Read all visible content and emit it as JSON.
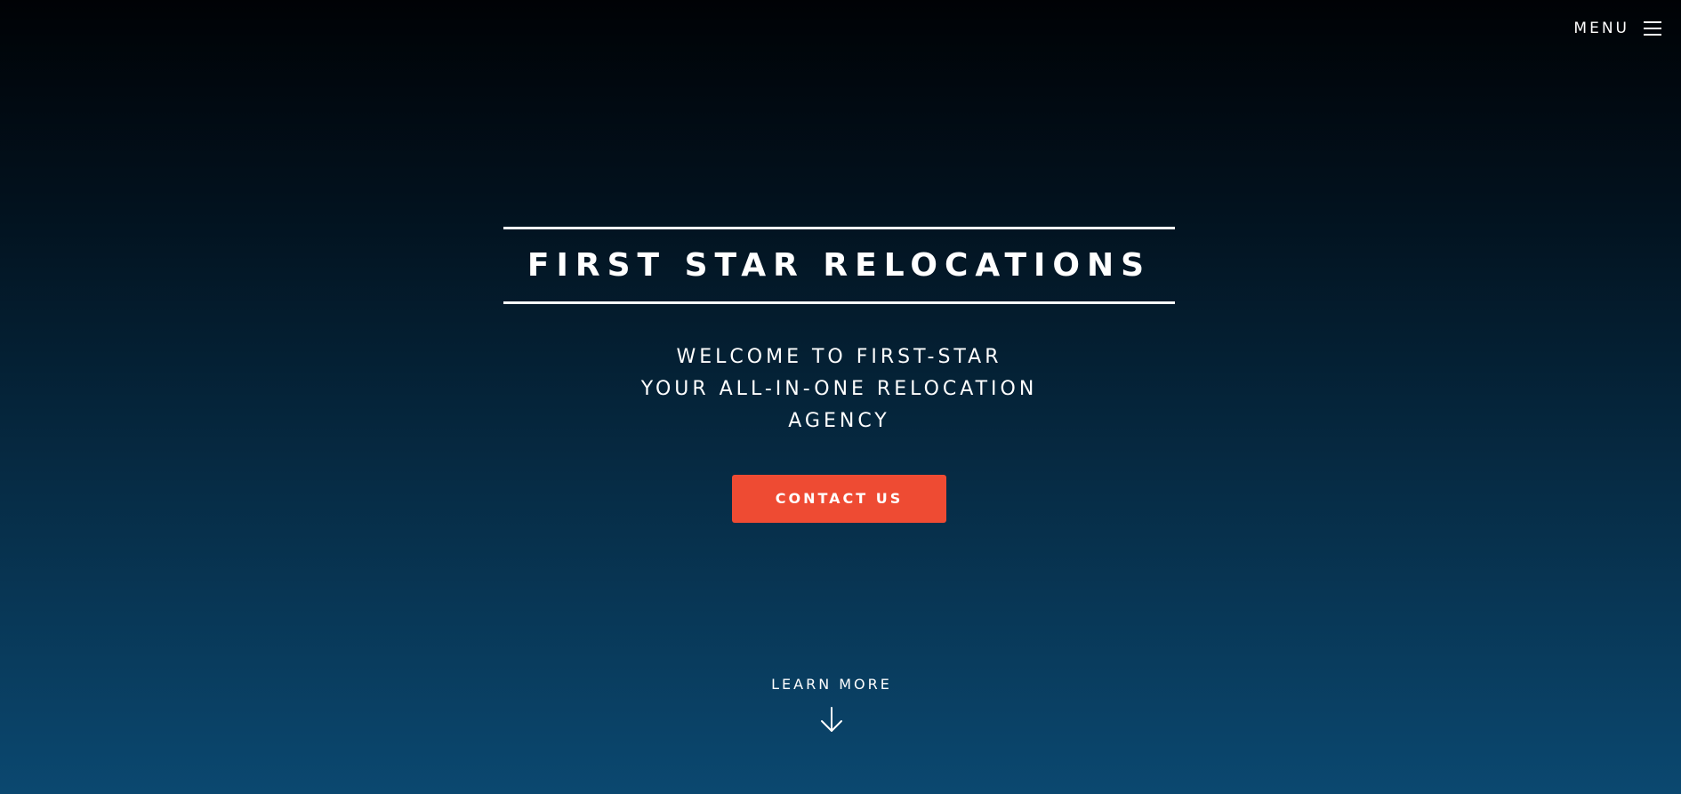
{
  "header": {
    "menu_label": "MENU",
    "menu_icon": "hamburger-icon"
  },
  "hero": {
    "title": "FIRST STAR RELOCATIONS",
    "tagline_lines": [
      "WELCOME TO FIRST-STAR",
      "YOUR ALL-IN-ONE RELOCATION",
      "AGENCY"
    ],
    "cta_label": "CONTACT US"
  },
  "footer_cta": {
    "label": "LEARN MORE",
    "icon": "arrow-down-icon"
  },
  "colors": {
    "accent": "#ee4b33",
    "background_top": "#000205",
    "background_bottom": "#0b4870",
    "text": "#ffffff"
  }
}
